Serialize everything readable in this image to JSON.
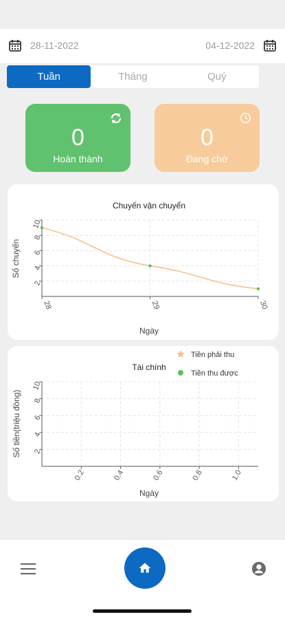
{
  "date_range": {
    "start": "28-11-2022",
    "end": "04-12-2022"
  },
  "tabs": [
    {
      "label": "Tuần",
      "active": true
    },
    {
      "label": "Tháng",
      "active": false
    },
    {
      "label": "Quý",
      "active": false
    }
  ],
  "stats": {
    "completed": {
      "value": "0",
      "label": "Hoàn thành",
      "icon": "refresh-icon",
      "color": "#60c26e"
    },
    "pending": {
      "value": "0",
      "label": "Đang chờ",
      "icon": "clock-icon",
      "color": "#f7cb9b"
    }
  },
  "chart_data": [
    {
      "type": "line",
      "title": "Chuyến vận chuyển",
      "xlabel": "Ngày",
      "ylabel": "Số chuyến",
      "x": [
        28,
        29,
        30
      ],
      "xticks": [
        "28",
        "29",
        "30"
      ],
      "yticks": [
        2,
        4,
        6,
        8,
        10
      ],
      "ylim": [
        0,
        10
      ],
      "grid": true,
      "series": [
        {
          "values": [
            9,
            4,
            1
          ],
          "color": "#f7c08a",
          "point_color": "#5cc05c"
        }
      ]
    },
    {
      "type": "line",
      "title": "Tài chính",
      "xlabel": "Ngày",
      "ylabel": "Số tiền(triệu đồng)",
      "xticks": [
        "0.2",
        "0.4",
        "0.6",
        "0.8",
        "1.0"
      ],
      "yticks": [
        2,
        4,
        6,
        8,
        10
      ],
      "xlim": [
        0,
        1.1
      ],
      "ylim": [
        0,
        10
      ],
      "grid": true,
      "legend_position": "top-right",
      "series": [
        {
          "name": "Tiền phải thu",
          "values": [],
          "marker": "star",
          "color": "#f7c08a"
        },
        {
          "name": "Tiền thu được",
          "values": [],
          "marker": "circle",
          "color": "#5cc05c"
        }
      ]
    }
  ],
  "nav": {
    "menu_icon": "menu-icon",
    "home_icon": "home-icon",
    "user_icon": "user-icon",
    "accent": "#0d6ac2"
  }
}
